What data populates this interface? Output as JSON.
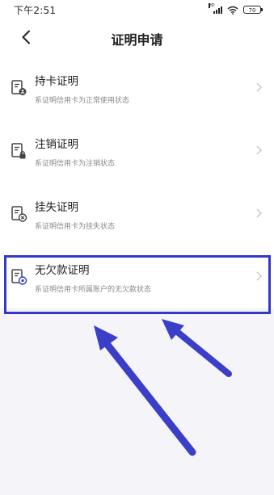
{
  "status_bar": {
    "time": "下午2:51",
    "signal_label": "HD",
    "battery": "70"
  },
  "header": {
    "title": "证明申请",
    "back_icon": "chevron-left-icon"
  },
  "items": [
    {
      "title": "持卡证明",
      "desc": "系证明信用卡为正常使用状态",
      "icon": "document-user-icon"
    },
    {
      "title": "注销证明",
      "desc": "系证明信用卡为注销状态",
      "icon": "document-lock-icon"
    },
    {
      "title": "挂失证明",
      "desc": "系证明信用卡为挂失状态",
      "icon": "document-cancel-icon"
    },
    {
      "title": "无欠款证明",
      "desc": "系证明信用卡所属账户的无欠款状态",
      "icon": "document-check-icon"
    }
  ],
  "colors": {
    "highlight": "#3438c9",
    "arrow": "#3b3fc8",
    "background": "#f4f4f9"
  }
}
